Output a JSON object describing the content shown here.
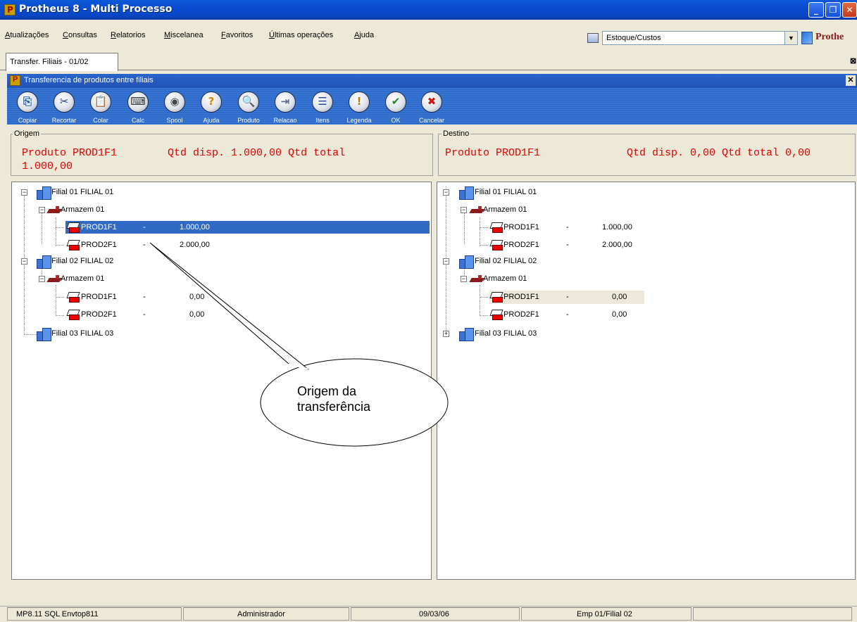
{
  "window": {
    "title": "Protheus 8 - Multi Processo"
  },
  "menu": {
    "items": [
      "Atualizações",
      "Consultas",
      "Relatorios",
      "Miscelanea",
      "Favoritos",
      "Últimas operações",
      "Ajuda"
    ]
  },
  "module_selector": {
    "value": "Estoque/Custos"
  },
  "brand": {
    "text": "Prothe"
  },
  "tab": {
    "label": "Transfer. Filiais - 01/02"
  },
  "dialog": {
    "title": "Transferencia de produtos entre filiais"
  },
  "toolbar": {
    "buttons": [
      {
        "label": "Copiar",
        "icon": "copy-icon",
        "glyph": "⎘"
      },
      {
        "label": "Recortar",
        "icon": "scissors-icon",
        "glyph": "✂"
      },
      {
        "label": "Colar",
        "icon": "paste-icon",
        "glyph": "📋"
      },
      {
        "label": "Calc",
        "icon": "calculator-icon",
        "glyph": "⌨"
      },
      {
        "label": "Spool",
        "icon": "spool-icon",
        "glyph": "◉"
      },
      {
        "label": "Ajuda",
        "icon": "help-icon",
        "glyph": "?"
      },
      {
        "label": "Produto",
        "icon": "product-icon",
        "glyph": "🔍"
      },
      {
        "label": "Relacao",
        "icon": "relation-icon",
        "glyph": "⇥"
      },
      {
        "label": "Itens",
        "icon": "items-icon",
        "glyph": "☰"
      },
      {
        "label": "Legenda",
        "icon": "legend-icon",
        "glyph": "!"
      },
      {
        "label": "OK",
        "icon": "ok-icon",
        "glyph": "✔"
      },
      {
        "label": "Cancelar",
        "icon": "cancel-icon",
        "glyph": "✖"
      }
    ]
  },
  "origem": {
    "title": "Origem",
    "summary_line1": "Produto PROD1F1        Qtd disp. 1.000,00 Qtd total",
    "summary_line2": "1.000,00",
    "tree": {
      "filial1": "Filial 01 FILIAL 01",
      "armazem1": "Armazem 01",
      "prod1": {
        "code": "PROD1F1",
        "dash": "-",
        "qty": "1.000,00"
      },
      "prod2": {
        "code": "PROD2F1",
        "dash": "-",
        "qty": "2.000,00"
      },
      "filial2": "Filial 02 FILIAL 02",
      "armazem2": "Armazem 01",
      "prod3": {
        "code": "PROD1F1",
        "dash": "-",
        "qty": "0,00"
      },
      "prod4": {
        "code": "PROD2F1",
        "dash": "-",
        "qty": "0,00"
      },
      "filial3": "Filial 03 FILIAL 03"
    }
  },
  "destino": {
    "title": "Destino",
    "summary_left": "Produto PROD1F1",
    "summary_right": "Qtd disp. 0,00 Qtd total 0,00",
    "tree": {
      "filial1": "Filial 01 FILIAL 01",
      "armazem1": "Armazem 01",
      "prod1": {
        "code": "PROD1F1",
        "dash": "-",
        "qty": "1.000,00"
      },
      "prod2": {
        "code": "PROD2F1",
        "dash": "-",
        "qty": "2.000,00"
      },
      "filial2": "Filial 02 FILIAL 02",
      "armazem2": "Armazem 01",
      "prod3": {
        "code": "PROD1F1",
        "dash": "-",
        "qty": "0,00"
      },
      "prod4": {
        "code": "PROD2F1",
        "dash": "-",
        "qty": "0,00"
      },
      "filial3": "Filial 03 FILIAL 03"
    }
  },
  "callout": {
    "line1": "Origem da",
    "line2": "transferência"
  },
  "statusbar": {
    "version": "MP8.11  SQL Envtop811",
    "user": "Administrador",
    "date": "09/03/06",
    "company": "Emp 01/Filial 02"
  }
}
